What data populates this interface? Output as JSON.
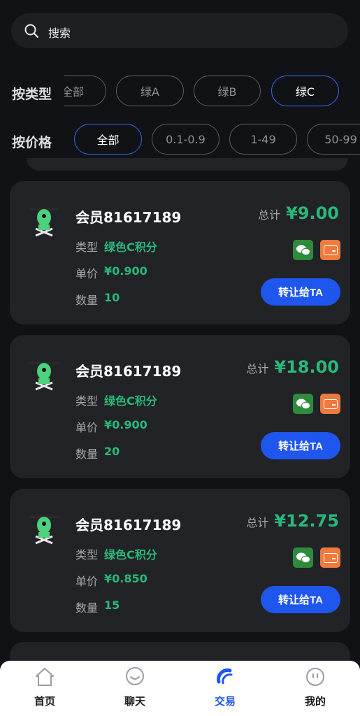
{
  "search": {
    "placeholder": "搜索"
  },
  "filters": {
    "type_label": "按类型",
    "type_chips": [
      {
        "label": "全部",
        "active": false
      },
      {
        "label": "绿A",
        "active": false
      },
      {
        "label": "绿B",
        "active": false
      },
      {
        "label": "绿C",
        "active": true
      }
    ],
    "price_label": "按价格",
    "price_chips": [
      {
        "label": "全部",
        "active": true
      },
      {
        "label": "0.1-0.9",
        "active": false
      },
      {
        "label": "1-49",
        "active": false
      },
      {
        "label": "50-99",
        "active": false
      }
    ]
  },
  "listings": [
    {
      "member": "会员81617189",
      "type_label": "类型",
      "type_value": "绿色C积分",
      "price_label": "单价",
      "price_value": "¥0.900",
      "qty_label": "数量",
      "qty_value": "10",
      "total_label": "总计",
      "total_value": "¥9.00",
      "button": "转让给TA"
    },
    {
      "member": "会员81617189",
      "type_label": "类型",
      "type_value": "绿色C积分",
      "price_label": "单价",
      "price_value": "¥0.900",
      "qty_label": "数量",
      "qty_value": "20",
      "total_label": "总计",
      "total_value": "¥18.00",
      "button": "转让给TA"
    },
    {
      "member": "会员81617189",
      "type_label": "类型",
      "type_value": "绿色C积分",
      "price_label": "单价",
      "price_value": "¥0.850",
      "qty_label": "数量",
      "qty_value": "15",
      "total_label": "总计",
      "total_value": "¥12.75",
      "button": "转让给TA"
    }
  ],
  "tabbar": [
    {
      "label": "首页",
      "icon": "home-icon",
      "active": false
    },
    {
      "label": "聊天",
      "icon": "chat-icon",
      "active": false
    },
    {
      "label": "交易",
      "icon": "trade-icon",
      "active": true
    },
    {
      "label": "我的",
      "icon": "profile-icon",
      "active": false
    }
  ],
  "colors": {
    "accent": "#1f56ee",
    "value_green": "#28b97a",
    "background": "#111215",
    "card": "#222327"
  }
}
